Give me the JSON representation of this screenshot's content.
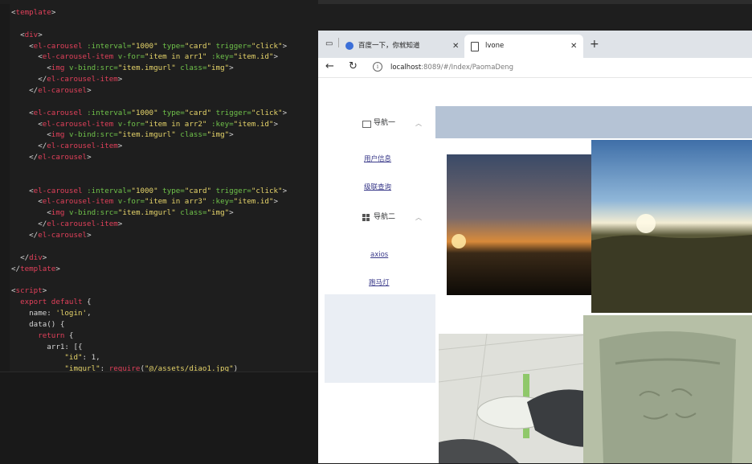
{
  "editor": {
    "lines": [
      [
        {
          "c": "plain",
          "t": "<"
        },
        {
          "c": "tag",
          "t": "template"
        },
        {
          "c": "plain",
          "t": ">"
        }
      ],
      [],
      [
        {
          "c": "plain",
          "t": "  <"
        },
        {
          "c": "tag",
          "t": "div"
        },
        {
          "c": "plain",
          "t": ">"
        }
      ],
      [
        {
          "c": "plain",
          "t": "    <"
        },
        {
          "c": "tag",
          "t": "el-carousel"
        },
        {
          "c": "plain",
          "t": " "
        },
        {
          "c": "attr",
          "t": ":interval="
        },
        {
          "c": "str",
          "t": "\"1000\""
        },
        {
          "c": "plain",
          "t": " "
        },
        {
          "c": "attr",
          "t": "type="
        },
        {
          "c": "str",
          "t": "\"card\""
        },
        {
          "c": "plain",
          "t": " "
        },
        {
          "c": "attr",
          "t": "trigger="
        },
        {
          "c": "str",
          "t": "\"click\""
        },
        {
          "c": "plain",
          "t": ">"
        }
      ],
      [
        {
          "c": "plain",
          "t": "      <"
        },
        {
          "c": "tag",
          "t": "el-carousel-item"
        },
        {
          "c": "plain",
          "t": " "
        },
        {
          "c": "attr",
          "t": "v-for="
        },
        {
          "c": "str",
          "t": "\"item in arr1\""
        },
        {
          "c": "plain",
          "t": " "
        },
        {
          "c": "attr",
          "t": ":key="
        },
        {
          "c": "str",
          "t": "\"item.id\""
        },
        {
          "c": "plain",
          "t": ">"
        }
      ],
      [
        {
          "c": "plain",
          "t": "        <"
        },
        {
          "c": "tag",
          "t": "img"
        },
        {
          "c": "plain",
          "t": " "
        },
        {
          "c": "attr",
          "t": "v-bind:src="
        },
        {
          "c": "str",
          "t": "\"item.imgurl\""
        },
        {
          "c": "plain",
          "t": " "
        },
        {
          "c": "attr",
          "t": "class="
        },
        {
          "c": "str",
          "t": "\"img\""
        },
        {
          "c": "plain",
          "t": ">"
        }
      ],
      [
        {
          "c": "plain",
          "t": "      </"
        },
        {
          "c": "tag",
          "t": "el-carousel-item"
        },
        {
          "c": "plain",
          "t": ">"
        }
      ],
      [
        {
          "c": "plain",
          "t": "    </"
        },
        {
          "c": "tag",
          "t": "el-carousel"
        },
        {
          "c": "plain",
          "t": ">"
        }
      ],
      [],
      [
        {
          "c": "plain",
          "t": "    <"
        },
        {
          "c": "tag",
          "t": "el-carousel"
        },
        {
          "c": "plain",
          "t": " "
        },
        {
          "c": "attr",
          "t": ":interval="
        },
        {
          "c": "str",
          "t": "\"1000\""
        },
        {
          "c": "plain",
          "t": " "
        },
        {
          "c": "attr",
          "t": "type="
        },
        {
          "c": "str",
          "t": "\"card\""
        },
        {
          "c": "plain",
          "t": " "
        },
        {
          "c": "attr",
          "t": "trigger="
        },
        {
          "c": "str",
          "t": "\"click\""
        },
        {
          "c": "plain",
          "t": ">"
        }
      ],
      [
        {
          "c": "plain",
          "t": "      <"
        },
        {
          "c": "tag",
          "t": "el-carousel-item"
        },
        {
          "c": "plain",
          "t": " "
        },
        {
          "c": "attr",
          "t": "v-for="
        },
        {
          "c": "str",
          "t": "\"item in arr2\""
        },
        {
          "c": "plain",
          "t": " "
        },
        {
          "c": "attr",
          "t": ":key="
        },
        {
          "c": "str",
          "t": "\"item.id\""
        },
        {
          "c": "plain",
          "t": ">"
        }
      ],
      [
        {
          "c": "plain",
          "t": "        <"
        },
        {
          "c": "tag",
          "t": "img"
        },
        {
          "c": "plain",
          "t": " "
        },
        {
          "c": "attr",
          "t": "v-bind:src="
        },
        {
          "c": "str",
          "t": "\"item.imgurl\""
        },
        {
          "c": "plain",
          "t": " "
        },
        {
          "c": "attr",
          "t": "class="
        },
        {
          "c": "str",
          "t": "\"img\""
        },
        {
          "c": "plain",
          "t": ">"
        }
      ],
      [
        {
          "c": "plain",
          "t": "      </"
        },
        {
          "c": "tag",
          "t": "el-carousel-item"
        },
        {
          "c": "plain",
          "t": ">"
        }
      ],
      [
        {
          "c": "plain",
          "t": "    </"
        },
        {
          "c": "tag",
          "t": "el-carousel"
        },
        {
          "c": "plain",
          "t": ">"
        }
      ],
      [],
      [],
      [
        {
          "c": "plain",
          "t": "    <"
        },
        {
          "c": "tag",
          "t": "el-carousel"
        },
        {
          "c": "plain",
          "t": " "
        },
        {
          "c": "attr",
          "t": ":interval="
        },
        {
          "c": "str",
          "t": "\"1000\""
        },
        {
          "c": "plain",
          "t": " "
        },
        {
          "c": "attr",
          "t": "type="
        },
        {
          "c": "str",
          "t": "\"card\""
        },
        {
          "c": "plain",
          "t": " "
        },
        {
          "c": "attr",
          "t": "trigger="
        },
        {
          "c": "str",
          "t": "\"click\""
        },
        {
          "c": "plain",
          "t": ">"
        }
      ],
      [
        {
          "c": "plain",
          "t": "      <"
        },
        {
          "c": "tag",
          "t": "el-carousel-item"
        },
        {
          "c": "plain",
          "t": " "
        },
        {
          "c": "attr",
          "t": "v-for="
        },
        {
          "c": "str",
          "t": "\"item in arr3\""
        },
        {
          "c": "plain",
          "t": " "
        },
        {
          "c": "attr",
          "t": ":key="
        },
        {
          "c": "str",
          "t": "\"item.id\""
        },
        {
          "c": "plain",
          "t": ">"
        }
      ],
      [
        {
          "c": "plain",
          "t": "        <"
        },
        {
          "c": "tag",
          "t": "img"
        },
        {
          "c": "plain",
          "t": " "
        },
        {
          "c": "attr",
          "t": "v-bind:src="
        },
        {
          "c": "str",
          "t": "\"item.imgurl\""
        },
        {
          "c": "plain",
          "t": " "
        },
        {
          "c": "attr",
          "t": "class="
        },
        {
          "c": "str",
          "t": "\"img\""
        },
        {
          "c": "plain",
          "t": ">"
        }
      ],
      [
        {
          "c": "plain",
          "t": "      </"
        },
        {
          "c": "tag",
          "t": "el-carousel-item"
        },
        {
          "c": "plain",
          "t": ">"
        }
      ],
      [
        {
          "c": "plain",
          "t": "    </"
        },
        {
          "c": "tag",
          "t": "el-carousel"
        },
        {
          "c": "plain",
          "t": ">"
        }
      ],
      [],
      [
        {
          "c": "plain",
          "t": "  </"
        },
        {
          "c": "tag",
          "t": "div"
        },
        {
          "c": "plain",
          "t": ">"
        }
      ],
      [
        {
          "c": "plain",
          "t": "</"
        },
        {
          "c": "tag",
          "t": "template"
        },
        {
          "c": "plain",
          "t": ">"
        }
      ],
      [],
      [
        {
          "c": "plain",
          "t": "<"
        },
        {
          "c": "tag",
          "t": "script"
        },
        {
          "c": "plain",
          "t": ">"
        }
      ],
      [
        {
          "c": "kw",
          "t": "  export default"
        },
        {
          "c": "plain",
          "t": " {"
        }
      ],
      [
        {
          "c": "plain",
          "t": "    name: "
        },
        {
          "c": "str",
          "t": "'login'"
        },
        {
          "c": "plain",
          "t": ","
        }
      ],
      [
        {
          "c": "plain",
          "t": "    data() {"
        }
      ],
      [
        {
          "c": "kw",
          "t": "      return"
        },
        {
          "c": "plain",
          "t": " {"
        }
      ],
      [
        {
          "c": "plain",
          "t": "        arr1: [{"
        }
      ],
      [
        {
          "c": "str",
          "t": "            \"id\""
        },
        {
          "c": "plain",
          "t": ": 1,"
        }
      ],
      [
        {
          "c": "str",
          "t": "            \"imgurl\""
        },
        {
          "c": "plain",
          "t": ": "
        },
        {
          "c": "kw",
          "t": "require"
        },
        {
          "c": "plain",
          "t": "("
        },
        {
          "c": "str",
          "t": "\"@/assets/diao1.jpg\""
        },
        {
          "c": "plain",
          "t": ")"
        }
      ]
    ]
  },
  "browser": {
    "tab1_title": "百度一下，你就知道",
    "tab2_title": "lvone",
    "new_tab": "+",
    "url_host": "localhost",
    "url_path": ":8089/#/Index/PaomaDeng"
  },
  "sidebar": {
    "nav1": "导航一",
    "item_user_info": "用户信息",
    "item_cascade": "级联查询",
    "nav2": "导航二",
    "item_axios": "axios",
    "item_marquee": "跑马灯"
  },
  "colors": {
    "header_band": "#b5c3d5",
    "sidebar_footer": "#eaeef4",
    "link": "#3a3a8a"
  }
}
